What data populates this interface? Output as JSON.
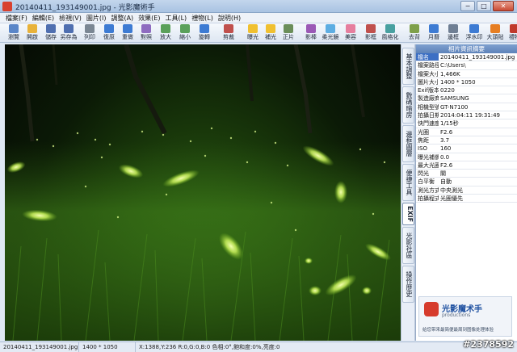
{
  "title": "20140411_193149001.jpg - 光影魔術手",
  "window_buttons": {
    "minimize": "−",
    "maximize": "□",
    "close": "✕"
  },
  "menu": [
    "檔案(F)",
    "編輯(E)",
    "檢視(V)",
    "圖片(I)",
    "調整(A)",
    "效果(E)",
    "工具(L)",
    "禮物(L)",
    "說明(H)"
  ],
  "toolbar": [
    {
      "label": "瀏覽",
      "icon": "browse-icon",
      "color": "#5a86c8"
    },
    {
      "label": "開啟",
      "icon": "open-icon",
      "color": "#e8b23a"
    },
    {
      "label": "儲存",
      "icon": "save-icon",
      "color": "#4f6fb0"
    },
    {
      "label": "另存為",
      "icon": "save-as-icon",
      "color": "#4f6fb0"
    },
    {
      "label": "列印",
      "icon": "print-icon",
      "color": "#7b8794"
    },
    {
      "label": "復原",
      "icon": "undo-icon",
      "color": "#3d7bd3"
    },
    {
      "label": "重做",
      "icon": "redo-icon",
      "color": "#3d7bd3"
    },
    {
      "label": "對照",
      "icon": "compare-icon",
      "color": "#8e6cc0"
    },
    {
      "label": "放大",
      "icon": "zoom-in-icon",
      "color": "#5aa05a"
    },
    {
      "label": "縮小",
      "icon": "zoom-out-icon",
      "color": "#5aa05a"
    },
    {
      "label": "旋轉",
      "icon": "rotate-icon",
      "color": "#3d7bd3"
    },
    {
      "label": "剪裁",
      "icon": "crop-icon",
      "color": "#c0504d"
    },
    {
      "label": "曝光",
      "icon": "exposure-icon",
      "color": "#f0c030"
    },
    {
      "label": "補光",
      "icon": "fill-light-icon",
      "color": "#f0c030"
    },
    {
      "label": "正片",
      "icon": "film-icon",
      "color": "#6b8e5a"
    },
    {
      "label": "影棒",
      "icon": "wand-icon",
      "color": "#9b59b6"
    },
    {
      "label": "柔光鏡",
      "icon": "soft-light-icon",
      "color": "#5dade2"
    },
    {
      "label": "美容",
      "icon": "beauty-icon",
      "color": "#e67e9e"
    },
    {
      "label": "影框",
      "icon": "frame-icon",
      "color": "#c0504d"
    },
    {
      "label": "風格化",
      "icon": "stylize-icon",
      "color": "#48a0a0"
    },
    {
      "label": "去背",
      "icon": "cutout-icon",
      "color": "#7ea04a"
    },
    {
      "label": "月曆",
      "icon": "calendar-icon",
      "color": "#3d7bd3"
    },
    {
      "label": "邊框",
      "icon": "border-icon",
      "color": "#6f7f94"
    },
    {
      "label": "浮水印",
      "icon": "watermark-icon",
      "color": "#3d7bd3"
    },
    {
      "label": "大頭貼",
      "icon": "sticker-icon",
      "color": "#e67e22"
    },
    {
      "label": "禮物",
      "icon": "gift-icon",
      "color": "#c0392b"
    }
  ],
  "side_tabs": [
    "基本調整",
    "數碼暗房",
    "邊框圖層",
    "便捷工具",
    "EXIF",
    "光影社區",
    "操作歷史"
  ],
  "active_tab": "EXIF",
  "exif": {
    "header": "相片資訊摘要",
    "rows": [
      {
        "k": "檔名",
        "v": "20140411_193149001.jpg"
      },
      {
        "k": "檔案路徑",
        "v": "C:\\Users\\"
      },
      {
        "k": "檔案大小",
        "v": "1,466K"
      },
      {
        "k": "圖片大小",
        "v": "1400 * 1050"
      },
      {
        "k": "Exif版本",
        "v": "0220"
      },
      {
        "k": "製造廠商",
        "v": "SAMSUNG"
      },
      {
        "k": "相機型號",
        "v": "GT-N7100"
      },
      {
        "k": "拍攝日期",
        "v": "2014:04:11 19:31:49"
      },
      {
        "k": "快門速度",
        "v": "1/15秒"
      },
      {
        "k": "光圈",
        "v": "F2.6"
      },
      {
        "k": "焦距",
        "v": "3.7"
      },
      {
        "k": "ISO",
        "v": "160"
      },
      {
        "k": "曝光補償",
        "v": "0.0"
      },
      {
        "k": "最大光圈",
        "v": "F2.6"
      },
      {
        "k": "閃光",
        "v": "關"
      },
      {
        "k": "白平衡",
        "v": "自動"
      },
      {
        "k": "測光方式",
        "v": "中央測光"
      },
      {
        "k": "拍攝程式",
        "v": "光圈優先"
      }
    ]
  },
  "ad": {
    "name": "光影魔术手",
    "sub": "productions",
    "tagline": "给您带来最简便最周到图像处理体验"
  },
  "status": {
    "file": "20140411_193149001.jpg",
    "size": "1400 * 1050",
    "pixel": "X:1388,Y:236 R:0,G:0,B:0 色相:0°,飽和度:0%,亮度:0"
  },
  "watermark": "#2378592",
  "colors": {
    "titlebar": "#a9c3e2",
    "panel_header": "#5d82b9",
    "accent": "#3c6fc4"
  }
}
